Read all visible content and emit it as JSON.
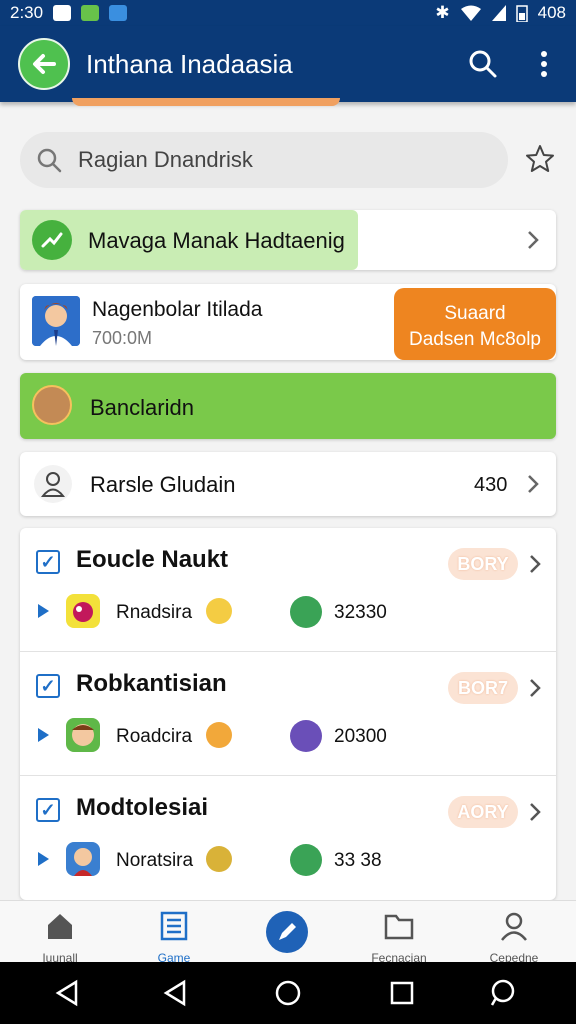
{
  "status_bar": {
    "time": "2:30",
    "battery": "408"
  },
  "app_bar": {
    "title": "Inthana Inadaasia"
  },
  "search": {
    "value": "Ragian Dnandrisk"
  },
  "banner_green": {
    "label": "Mavaga Manak Hadtaenig"
  },
  "promo": {
    "title": "Nagenbolar Itilada",
    "subtitle": "700:0M",
    "button_line1": "Suaard",
    "button_line2": "Dadsen Mc8olp"
  },
  "banner_bar": {
    "label": "Banclaridn"
  },
  "profile_row": {
    "label": "Rarsle Gludain",
    "count": "430"
  },
  "list": {
    "items": [
      {
        "title": "Eoucle Naukt",
        "badge": "BORY",
        "game": "Rnadsira",
        "value": "32330"
      },
      {
        "title": "Robkantisian",
        "badge": "BOR7",
        "game": "Roadcira",
        "value": "20300"
      },
      {
        "title": "Modtolesiai",
        "badge": "AORY",
        "game": "Noratsira",
        "value": "33 38"
      }
    ]
  },
  "bottom_nav": {
    "items": [
      {
        "label": "Iuunall"
      },
      {
        "label": "Game"
      },
      {
        "label": "Fecnacian"
      },
      {
        "label": "Cepedne"
      }
    ]
  },
  "colors": {
    "app_bar": "#0b3a78",
    "accent_green": "#7ac94a",
    "accent_orange": "#ee8520",
    "accent_blue": "#1f6fc7"
  }
}
